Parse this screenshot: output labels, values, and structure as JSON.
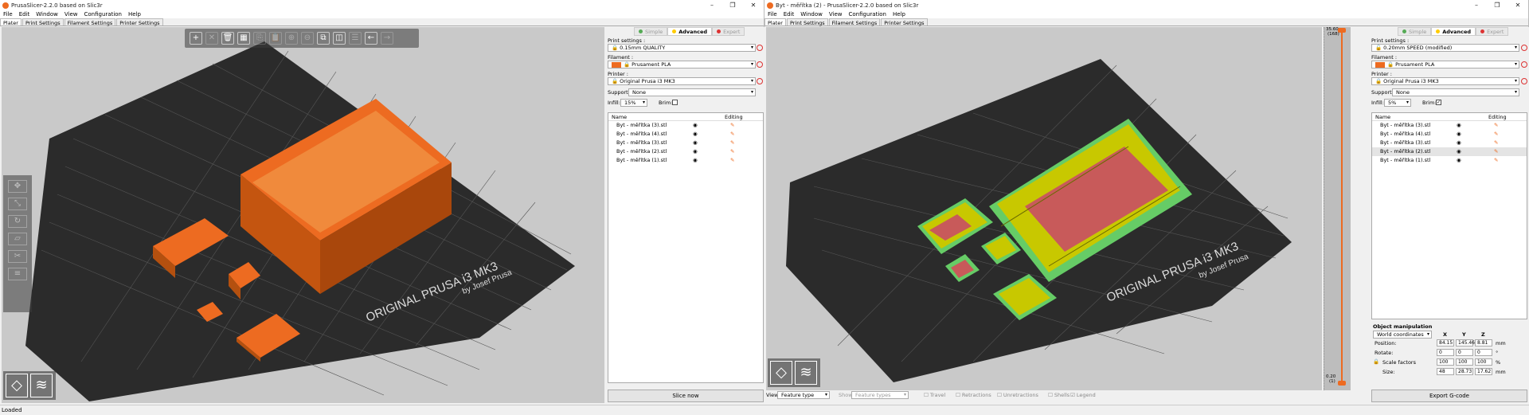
{
  "left": {
    "title": "PrusaSlicer-2.2.0 based on Slic3r",
    "menu": [
      "File",
      "Edit",
      "Window",
      "View",
      "Configuration",
      "Help"
    ],
    "tabs": [
      "Plater",
      "Print Settings",
      "Filament Settings",
      "Printer Settings"
    ],
    "modes": [
      "Simple",
      "Advanced",
      "Expert"
    ],
    "print_settings_label": "Print settings :",
    "print_settings_value": "0.15mm QUALITY",
    "filament_label": "Filament :",
    "filament_value": "Prusament PLA",
    "printer_label": "Printer :",
    "printer_value": "Original Prusa i3 MK3",
    "supports_label": "Supports:",
    "supports_value": "None",
    "infill_label": "Infill:",
    "infill_value": "15%",
    "brim_label": "Brim:",
    "col_name": "Name",
    "col_editing": "Editing",
    "objects": [
      "Byt - měřítka (3).stl",
      "Byt - měřítka (4).stl",
      "Byt - měřítka (3).stl",
      "Byt - měřítka (2).stl",
      "Byt - měřítka (1).stl"
    ],
    "slice_button": "Slice now",
    "bed_text1": "ORIGINAL PRUSA i3  MK3",
    "bed_text2": "by Josef Prusa"
  },
  "right": {
    "title": "Byt - měřítka (2) - PrusaSlicer-2.2.0 based on Slic3r",
    "menu": [
      "File",
      "Edit",
      "Window",
      "View",
      "Configuration",
      "Help"
    ],
    "tabs": [
      "Plater",
      "Print Settings",
      "Filament Settings",
      "Printer Settings"
    ],
    "modes": [
      "Simple",
      "Advanced",
      "Expert"
    ],
    "print_settings_label": "Print settings :",
    "print_settings_value": "0.20mm SPEED (modified)",
    "filament_label": "Filament :",
    "filament_value": "Prusament PLA",
    "printer_label": "Printer :",
    "printer_value": "Original Prusa i3 MK3",
    "supports_label": "Supports:",
    "supports_value": "None",
    "infill_label": "Infill:",
    "infill_value": "5%",
    "brim_label": "Brim:",
    "col_name": "Name",
    "col_editing": "Editing",
    "objects": [
      "Byt - měřítka (3).stl",
      "Byt - měřítka (4).stl",
      "Byt - měřítka (3).stl",
      "Byt - měřítka (2).stl",
      "Byt - měřítka (1).stl"
    ],
    "object_manipulation": "Object manipulation",
    "coord_system": "World coordinates",
    "axis_x": "X",
    "axis_y": "Y",
    "axis_z": "Z",
    "position_label": "Position:",
    "position": [
      "84.15",
      "145.46",
      "8.81"
    ],
    "rotate_label": "Rotate:",
    "rotate": [
      "0",
      "0",
      "0"
    ],
    "scale_label": "Scale factors",
    "scale": [
      "100",
      "100",
      "100"
    ],
    "size_label": "Size:",
    "size": [
      "48",
      "28.73",
      "17.62"
    ],
    "unit_mm": "mm",
    "unit_deg": "°",
    "unit_pct": "%",
    "export_button": "Export G-code",
    "slider_top": "35.60",
    "slider_top2": "(168)",
    "slider_bottom": "0.20",
    "slider_bottom2": "(1)",
    "view_label": "View",
    "view_value": "Feature type",
    "show_label": "Show",
    "show_value": "Feature types",
    "legend_options": [
      "Travel",
      "Retractions",
      "Unretractions",
      "Shells",
      "Legend"
    ],
    "bed_text1": "ORIGINAL PRUSA i3  MK3",
    "bed_text2": "by Josef Prusa"
  },
  "status": "Loaded",
  "colors": {
    "orange": "#ed6b21",
    "toolpath_yellow": "#c8c800",
    "perimeter_green": "#66cc66",
    "infill_red": "#c85a5a"
  }
}
